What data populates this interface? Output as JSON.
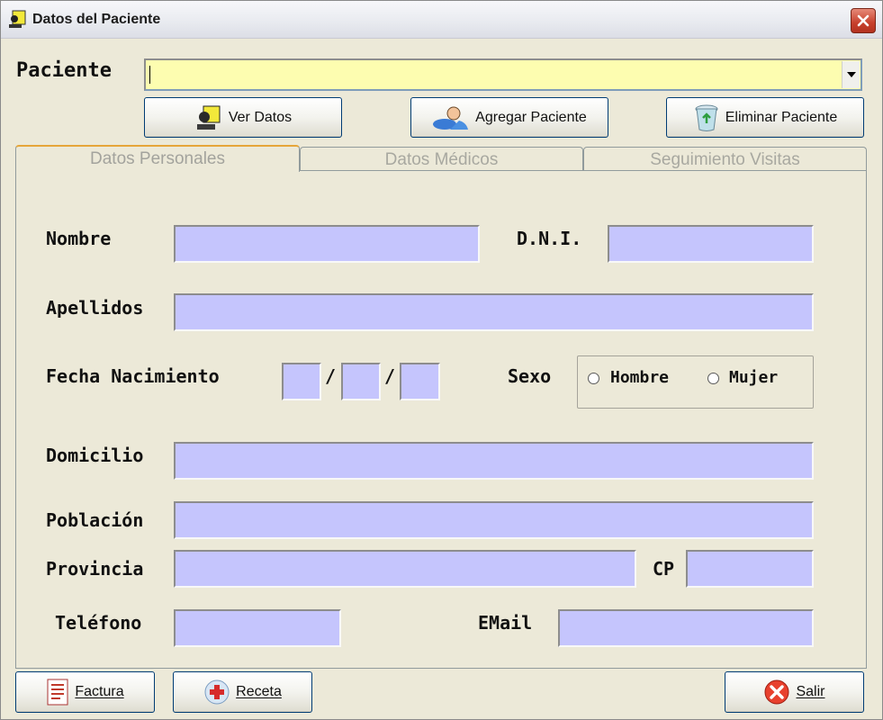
{
  "window": {
    "title": "Datos del Paciente"
  },
  "patient": {
    "label": "Paciente",
    "value": ""
  },
  "toolbar": {
    "view_label": "Ver Datos",
    "add_label": "Agregar Paciente",
    "delete_label": "Eliminar Paciente"
  },
  "tabs": [
    {
      "label": "Datos Personales",
      "active": true
    },
    {
      "label": "Datos Médicos",
      "active": false
    },
    {
      "label": "Seguimiento Visitas",
      "active": false
    }
  ],
  "form": {
    "nombre_label": "Nombre",
    "dni_label": "D.N.I.",
    "apellidos_label": "Apellidos",
    "fecha_label": "Fecha Nacimiento",
    "fecha_sep": "/",
    "sexo_label": "Sexo",
    "sexo_options": [
      "Hombre",
      "Mujer"
    ],
    "domicilio_label": "Domicilio",
    "poblacion_label": "Población",
    "provincia_label": "Provincia",
    "cp_label": "CP",
    "telefono_label": "Teléfono",
    "email_label": "EMail"
  },
  "footer": {
    "factura_label": "Factura",
    "receta_label": "Receta",
    "salir_label": "Salir"
  },
  "colors": {
    "field": "#c5c5fd",
    "combo": "#fdfdb0",
    "window": "#ece9d8"
  }
}
